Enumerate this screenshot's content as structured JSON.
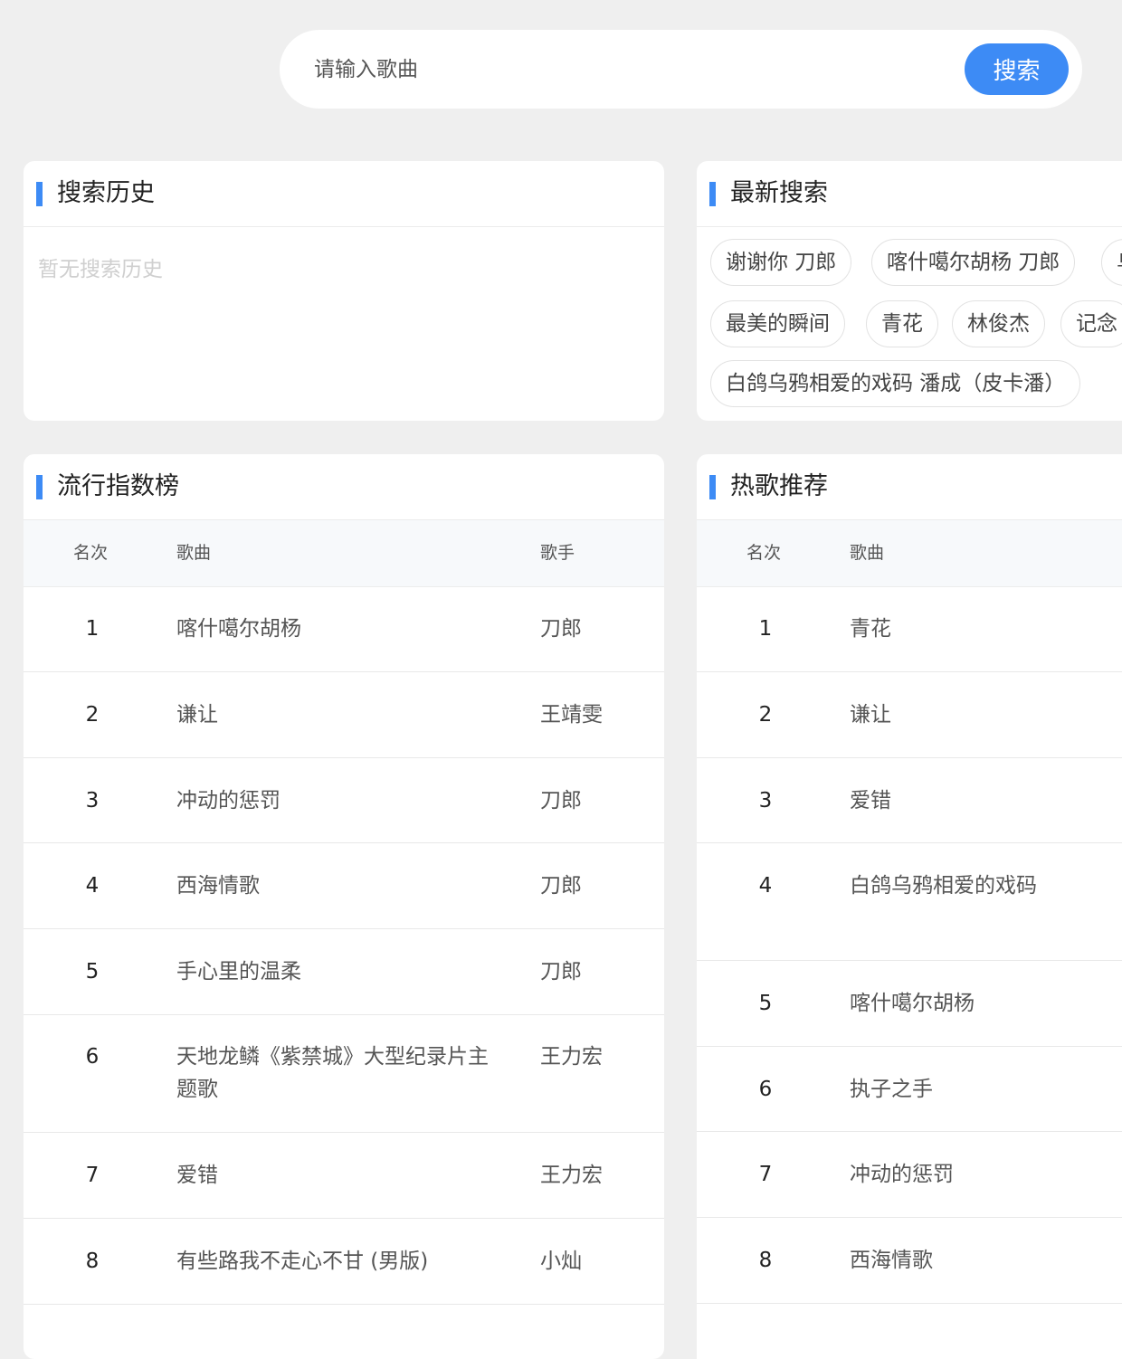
{
  "search": {
    "placeholder": "请输入歌曲",
    "button_label": "搜索"
  },
  "history": {
    "title": "搜索历史",
    "empty_text": "暂无搜索历史"
  },
  "latest": {
    "title": "最新搜索",
    "tags": [
      "谢谢你 刀郎",
      "喀什噶尔胡杨 刀郎",
      "乌",
      "最美的瞬间",
      "青花",
      "林俊杰",
      "记念",
      "白鸽乌鸦相爱的戏码 潘成（皮卡潘）"
    ]
  },
  "popular": {
    "title": "流行指数榜",
    "headers": {
      "rank": "名次",
      "song": "歌曲",
      "artist": "歌手"
    },
    "rows": [
      {
        "rank": "1",
        "song": "喀什噶尔胡杨",
        "artist": "刀郎"
      },
      {
        "rank": "2",
        "song": "谦让",
        "artist": "王靖雯"
      },
      {
        "rank": "3",
        "song": "冲动的惩罚",
        "artist": "刀郎"
      },
      {
        "rank": "4",
        "song": "西海情歌",
        "artist": "刀郎"
      },
      {
        "rank": "5",
        "song": "手心里的温柔",
        "artist": "刀郎"
      },
      {
        "rank": "6",
        "song": "天地龙鳞《紫禁城》大型纪录片主题歌",
        "artist": "王力宏"
      },
      {
        "rank": "7",
        "song": "爱错",
        "artist": "王力宏"
      },
      {
        "rank": "8",
        "song": "有些路我不走心不甘 (男版)",
        "artist": "小灿"
      }
    ]
  },
  "hot": {
    "title": "热歌推荐",
    "headers": {
      "rank": "名次",
      "song": "歌曲"
    },
    "rows": [
      {
        "rank": "1",
        "song": "青花"
      },
      {
        "rank": "2",
        "song": "谦让"
      },
      {
        "rank": "3",
        "song": "爱错"
      },
      {
        "rank": "4",
        "song": "白鸽乌鸦相爱的戏码"
      },
      {
        "rank": "5",
        "song": "喀什噶尔胡杨"
      },
      {
        "rank": "6",
        "song": "执子之手"
      },
      {
        "rank": "7",
        "song": "冲动的惩罚"
      },
      {
        "rank": "8",
        "song": "西海情歌"
      }
    ]
  },
  "colors": {
    "accent": "#3d8bf5",
    "background": "#efefef"
  }
}
